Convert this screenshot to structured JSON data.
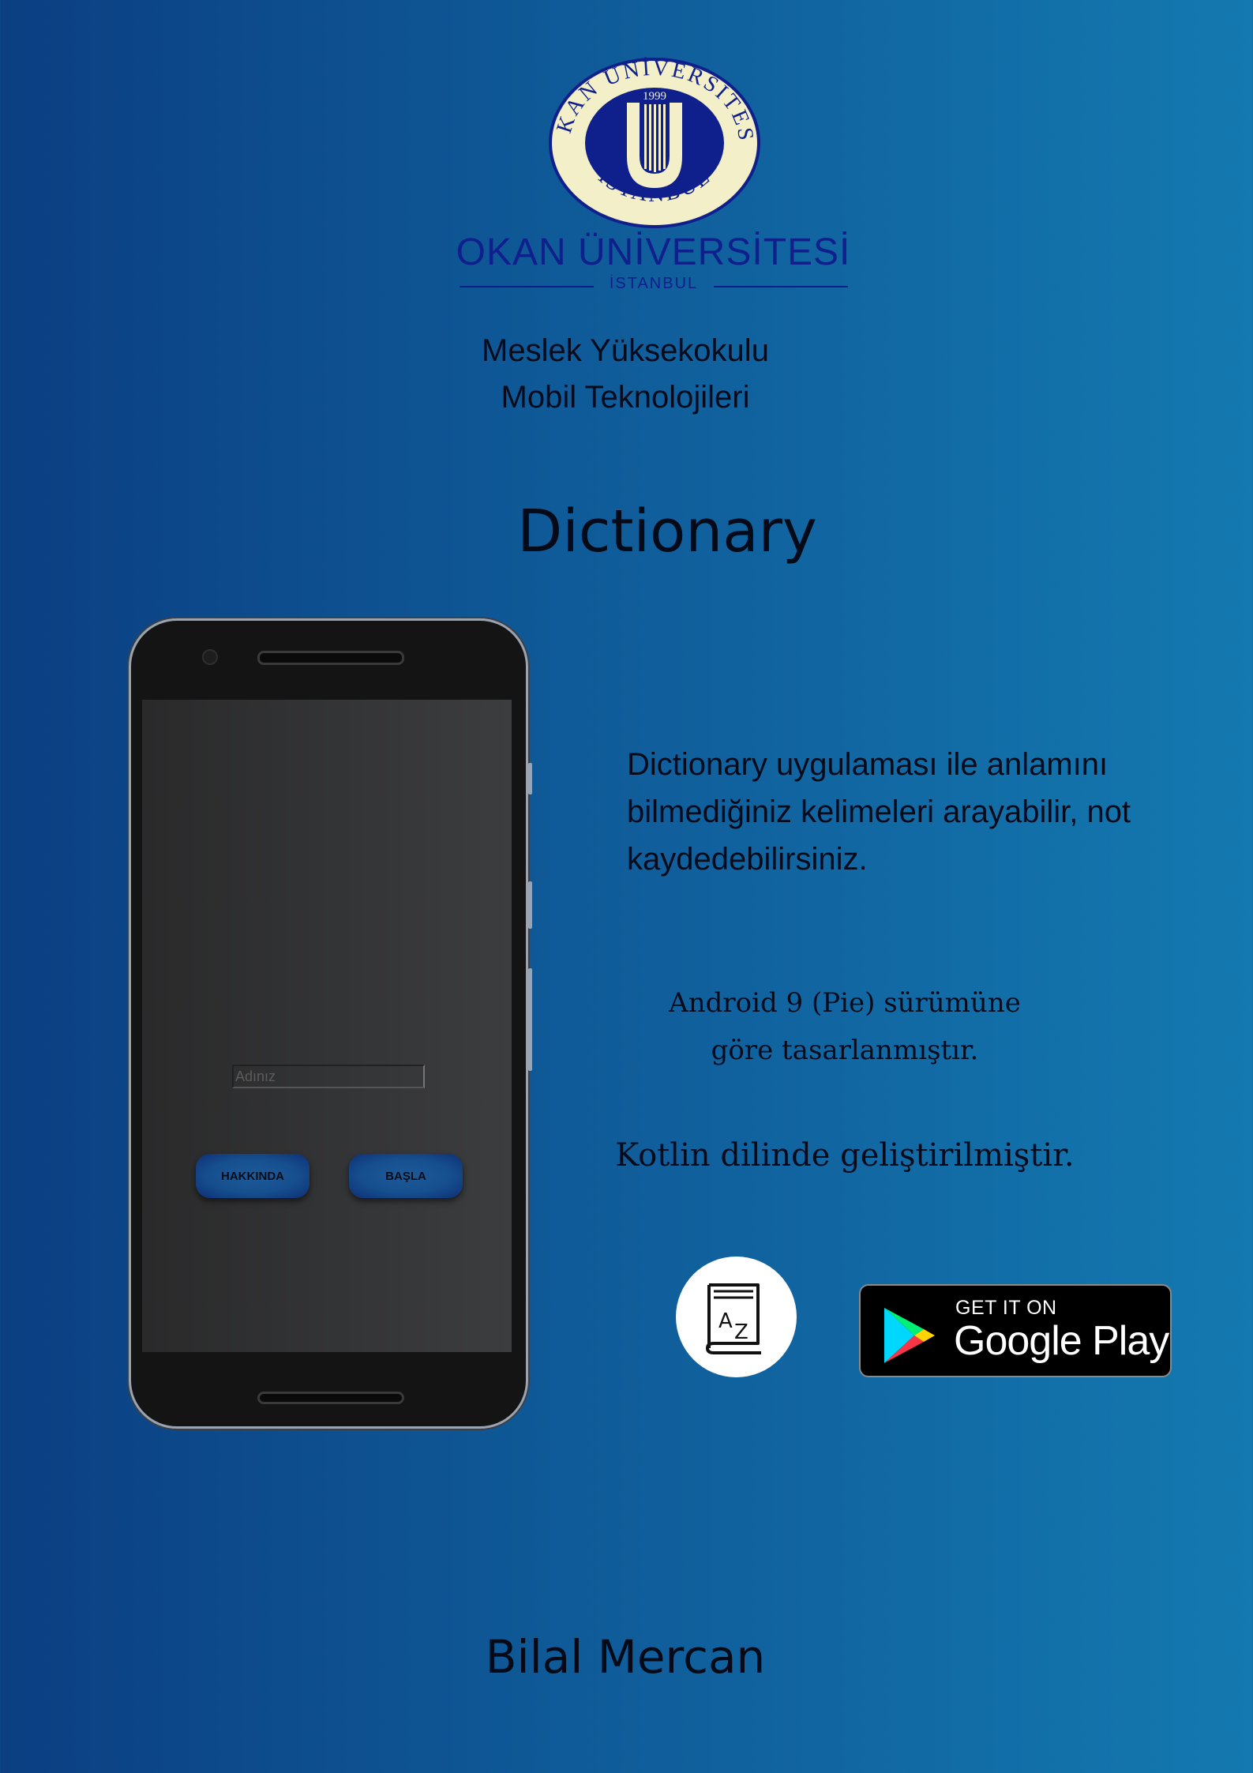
{
  "logo": {
    "seal_text": "OKAN ÜNİVERSİTESİ • İSTANBUL •",
    "seal_year": "1999",
    "wordmark": "OKAN ÜNİVERSİTESİ",
    "subtitle": "İSTANBUL"
  },
  "school": {
    "line1": "Meslek Yüksekokulu",
    "line2": "Mobil Teknolojileri"
  },
  "app_title": "Dictionary",
  "phone": {
    "name_placeholder": "Adınız",
    "about_button": "HAKKINDA",
    "start_button": "BAŞLA"
  },
  "description": "Dictionary uygulaması ile anlamını bilmediğiniz kelimeleri arayabilir, not kaydedebilirsiniz.",
  "android_note": {
    "line1": "Android 9 (Pie) sürümüne",
    "line2": "göre tasarlanmıştır."
  },
  "kotlin_note": "Kotlin dilinde geliştirilmiştir.",
  "play_badge": {
    "get_it_on": "GET IT ON",
    "store_name": "Google Play"
  },
  "author": "Bilal Mercan",
  "colors": {
    "background_left": "#0b3f82",
    "background_right": "#1479b0",
    "brand_navy": "#0f1f8c",
    "seal_cream": "#f3efc8"
  },
  "icons": [
    "university-seal-icon",
    "dictionary-app-icon",
    "google-play-logo-icon"
  ]
}
